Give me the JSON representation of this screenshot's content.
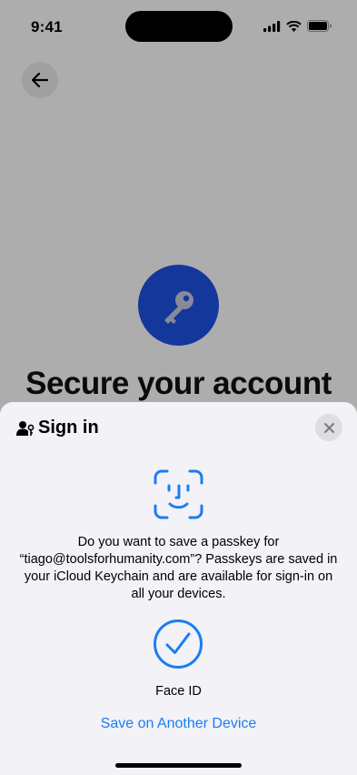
{
  "status_bar": {
    "time": "9:41",
    "icons": [
      "cellular-signal-icon",
      "wifi-icon",
      "battery-icon"
    ]
  },
  "background_page": {
    "back_icon": "arrow-left-icon",
    "hero_icon": "key-icon",
    "heading": "Secure your account",
    "accent_color": "#1c51e4"
  },
  "sheet": {
    "title": "Sign in",
    "title_icon": "person-key-icon",
    "close_icon": "close-icon",
    "illustration": "face-id-icon",
    "message": "Do you want to save a passkey for “tiago@toolsforhumanity.com”? Passkeys are saved in your iCloud Keychain and are available for sign-in on all your devices.",
    "status_icon": "checkmark-circle-icon",
    "method_label": "Face ID",
    "alternate_action": "Save on Another Device",
    "link_color": "#1a7ef2"
  }
}
